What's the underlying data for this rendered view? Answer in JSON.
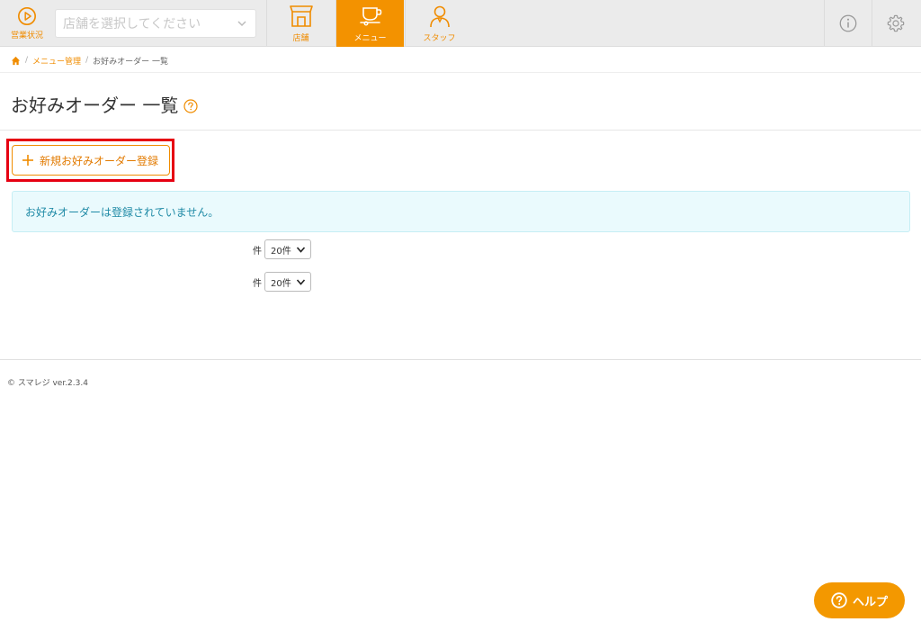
{
  "header": {
    "status_label": "営業状況",
    "store_select_placeholder": "店舗を選択してください",
    "nav": {
      "store_label": "店舗",
      "menu_label": "メニュー",
      "staff_label": "スタッフ"
    }
  },
  "breadcrumb": {
    "items": [
      "メニュー管理",
      "お好みオーダー 一覧"
    ]
  },
  "page": {
    "title": "お好みオーダー 一覧",
    "new_button_label": "新規お好みオーダー登録",
    "empty_message": "お好みオーダーは登録されていません。",
    "per_page_unit": "件",
    "per_page_value": "20件"
  },
  "footer": {
    "copyright": "© スマレジ ver.2.3.4"
  },
  "help_button_label": "ヘルプ",
  "colors": {
    "accent": "#f39200",
    "highlight": "#e60012",
    "alert_bg": "#eafafd",
    "alert_text": "#1f8aa6"
  }
}
